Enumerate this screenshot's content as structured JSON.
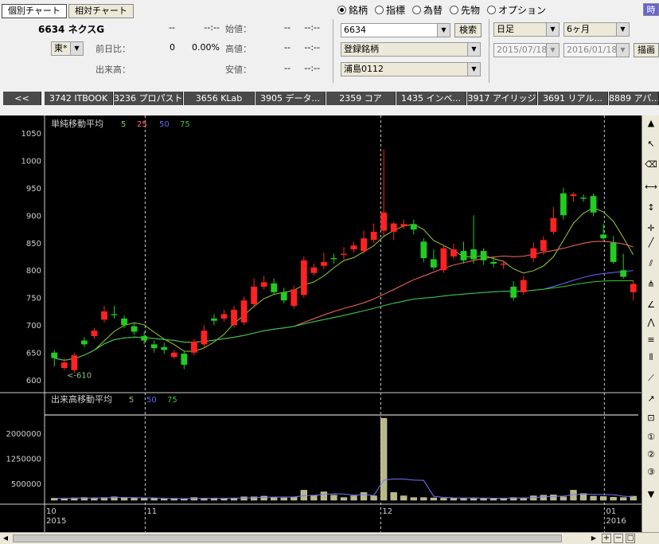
{
  "tabs": {
    "individual": "個別チャート",
    "relative": "相対チャート"
  },
  "stock": {
    "code_name": "6634 ネクスG",
    "market": "東*"
  },
  "quote_left": [
    {
      "label": "",
      "value": "--",
      "time": "--:--"
    },
    {
      "label": "前日比：",
      "value": "0",
      "time": "0.00%"
    },
    {
      "label": "出来高：",
      "value": "",
      "time": ""
    }
  ],
  "quote_right": [
    {
      "label": "始値：",
      "value": "--",
      "time": "--:--"
    },
    {
      "label": "高値：",
      "value": "--",
      "time": "--:--"
    },
    {
      "label": "安値：",
      "value": "--",
      "time": "--:--"
    }
  ],
  "radios": [
    {
      "label": "銘柄",
      "selected": true
    },
    {
      "label": "指標",
      "selected": false
    },
    {
      "label": "為替",
      "selected": false
    },
    {
      "label": "先物",
      "selected": false
    },
    {
      "label": "オプション",
      "selected": false
    }
  ],
  "search": {
    "code": "6634",
    "button": "検索"
  },
  "registered": "登録銘柄",
  "watchlist": "浦島0112",
  "period": {
    "type": "日足",
    "span": "6ヶ月",
    "from": "2015/07/18",
    "to": "2016/01/18",
    "draw": "描画"
  },
  "corner_button": "時",
  "ticker_tabs": [
    "<<",
    "3742 ITBOOK",
    "3236 プロパスト",
    "3656 KLab",
    "3905 データ...",
    "2359 コア",
    "1435 インベ...",
    "3917 アイリッジ",
    "3691 リアル...",
    "8889 アパ..."
  ],
  "price_panel": {
    "title": "単純移動平均",
    "ma": [
      "5",
      "25",
      "50",
      "75"
    ],
    "ma_colors": [
      "#9acd32",
      "#ff6666",
      "#6666ff",
      "#33cc33"
    ],
    "annotation": "610"
  },
  "volume_panel": {
    "title": "出来高移動平均",
    "ma": [
      "5",
      "50",
      "75"
    ]
  },
  "x_axis": {
    "months": [
      "10",
      "11",
      "12",
      "01"
    ],
    "years": [
      "2015",
      "2016"
    ]
  },
  "chart_data": {
    "type": "candlestick",
    "ylim": [
      580,
      1070
    ],
    "yticks": [
      600,
      650,
      700,
      750,
      800,
      850,
      900,
      950,
      1000,
      1050
    ],
    "vol_ticks": [
      {
        "value": 500000,
        "label": "500000"
      },
      {
        "value": 1250000,
        "label": "1250000"
      },
      {
        "value": 2000000,
        "label": "2000000"
      }
    ],
    "vol_max": 2600000,
    "candles": [
      [
        650,
        640,
        655,
        625
      ],
      [
        622,
        632,
        640,
        618
      ],
      [
        618,
        645,
        650,
        612
      ],
      [
        672,
        665,
        678,
        660
      ],
      [
        680,
        690,
        695,
        675
      ],
      [
        710,
        725,
        735,
        705
      ],
      [
        720,
        718,
        735,
        712
      ],
      [
        712,
        700,
        718,
        695
      ],
      [
        698,
        688,
        705,
        682
      ],
      [
        680,
        672,
        688,
        665
      ],
      [
        665,
        658,
        672,
        650
      ],
      [
        660,
        655,
        668,
        648
      ],
      [
        642,
        650,
        655,
        638
      ],
      [
        648,
        628,
        652,
        620
      ],
      [
        650,
        670,
        675,
        645
      ],
      [
        665,
        690,
        700,
        660
      ],
      [
        712,
        708,
        720,
        700
      ],
      [
        712,
        720,
        728,
        706
      ],
      [
        700,
        728,
        735,
        695
      ],
      [
        705,
        745,
        752,
        700
      ],
      [
        738,
        770,
        785,
        732
      ],
      [
        770,
        778,
        790,
        765
      ],
      [
        776,
        760,
        785,
        755
      ],
      [
        760,
        745,
        768,
        740
      ],
      [
        735,
        765,
        772,
        730
      ],
      [
        755,
        818,
        825,
        750
      ],
      [
        795,
        805,
        812,
        790
      ],
      [
        808,
        815,
        832,
        802
      ],
      [
        822,
        820,
        830,
        812
      ],
      [
        828,
        830,
        842,
        820
      ],
      [
        838,
        845,
        852,
        832
      ],
      [
        835,
        858,
        872,
        830
      ],
      [
        855,
        870,
        885,
        850
      ],
      [
        872,
        905,
        1020,
        862
      ],
      [
        870,
        885,
        888,
        855
      ],
      [
        880,
        884,
        892,
        875
      ],
      [
        884,
        874,
        892,
        865
      ],
      [
        852,
        822,
        858,
        815
      ],
      [
        820,
        805,
        838,
        800
      ],
      [
        800,
        840,
        845,
        795
      ],
      [
        825,
        838,
        848,
        820
      ],
      [
        835,
        818,
        852,
        812
      ],
      [
        838,
        820,
        900,
        812
      ],
      [
        835,
        818,
        840,
        810
      ],
      [
        815,
        812,
        825,
        805
      ],
      [
        810,
        812,
        818,
        802
      ],
      [
        770,
        750,
        780,
        745
      ],
      [
        760,
        782,
        790,
        755
      ],
      [
        822,
        840,
        850,
        815
      ],
      [
        835,
        855,
        862,
        828
      ],
      [
        870,
        895,
        915,
        865
      ],
      [
        940,
        900,
        950,
        892
      ],
      [
        935,
        938,
        942,
        925
      ],
      [
        932,
        930,
        938,
        925
      ],
      [
        935,
        905,
        940,
        898
      ],
      [
        865,
        858,
        885,
        855
      ],
      [
        850,
        815,
        862,
        812
      ],
      [
        800,
        788,
        830,
        785
      ],
      [
        760,
        775,
        782,
        745
      ]
    ],
    "volumes": [
      60000,
      50000,
      70000,
      80000,
      70000,
      80000,
      100000,
      70000,
      60000,
      50000,
      60000,
      40000,
      50000,
      40000,
      80000,
      60000,
      60000,
      50000,
      60000,
      100000,
      100000,
      120000,
      90000,
      70000,
      100000,
      300000,
      150000,
      250000,
      150000,
      80000,
      130000,
      230000,
      130000,
      2450000,
      230000,
      130000,
      80000,
      80000,
      70000,
      60000,
      60000,
      60000,
      70000,
      60000,
      50000,
      60000,
      80000,
      70000,
      130000,
      150000,
      160000,
      100000,
      300000,
      200000,
      120000,
      110000,
      90000,
      80000,
      120000
    ],
    "month_index": [
      9.6,
      33.2,
      55.6
    ]
  }
}
